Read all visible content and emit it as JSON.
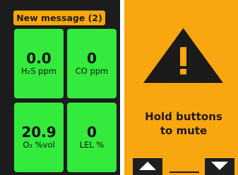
{
  "banner": {
    "text": "New message (2)"
  },
  "readings": [
    {
      "value": "0.0",
      "unit": "H₂S ppm"
    },
    {
      "value": "0",
      "unit": "CO ppm"
    },
    {
      "value": "20.9",
      "unit": "O₂ %vol"
    },
    {
      "value": "0",
      "unit": "LEL %"
    }
  ],
  "alert": {
    "icon": "warning-triangle-icon",
    "line1": "Hold buttons",
    "line2": "to mute"
  },
  "buttons": {
    "up_icon": "triangle-up-icon",
    "down_icon": "triangle-down-icon"
  },
  "colors": {
    "banner": "#f7a80c",
    "tile_ok": "#33ea3d",
    "alert_bg": "#f9a710",
    "dark": "#1c1c1c"
  }
}
